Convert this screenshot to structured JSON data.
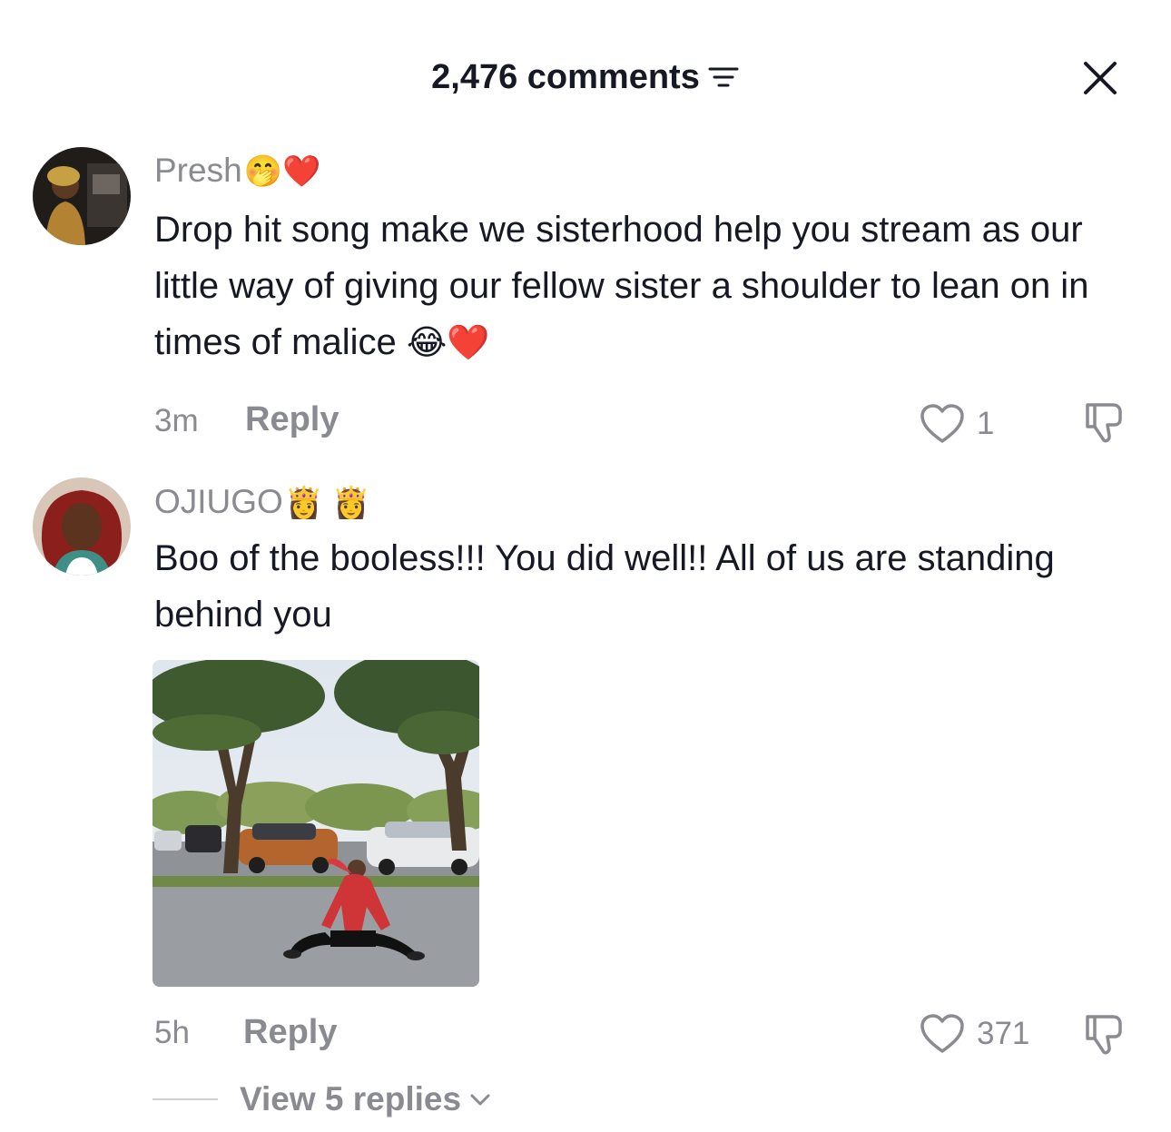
{
  "header": {
    "title": "2,476 comments",
    "filter_icon": "filter-icon",
    "close_icon": "close-icon"
  },
  "comments": [
    {
      "username": "Presh",
      "username_emojis": "🤭❤️",
      "text": "Drop hit song make we sisterhood help you stream as our little way of giving our fellow sister a shoulder to lean on in times of malice",
      "text_emojis": "😂❤️",
      "time": "3m",
      "reply_label": "Reply",
      "likes": "1"
    },
    {
      "username": "OJIUGO",
      "username_emojis": "👸 👸",
      "text": "Boo of the booless!!! You did well!! All of us are standing behind you",
      "time": "5h",
      "reply_label": "Reply",
      "likes": "371",
      "view_replies": "View 5 replies"
    }
  ],
  "colors": {
    "text": "#161823",
    "muted": "#8a8b91",
    "heart_emoji": "#e0243a"
  }
}
